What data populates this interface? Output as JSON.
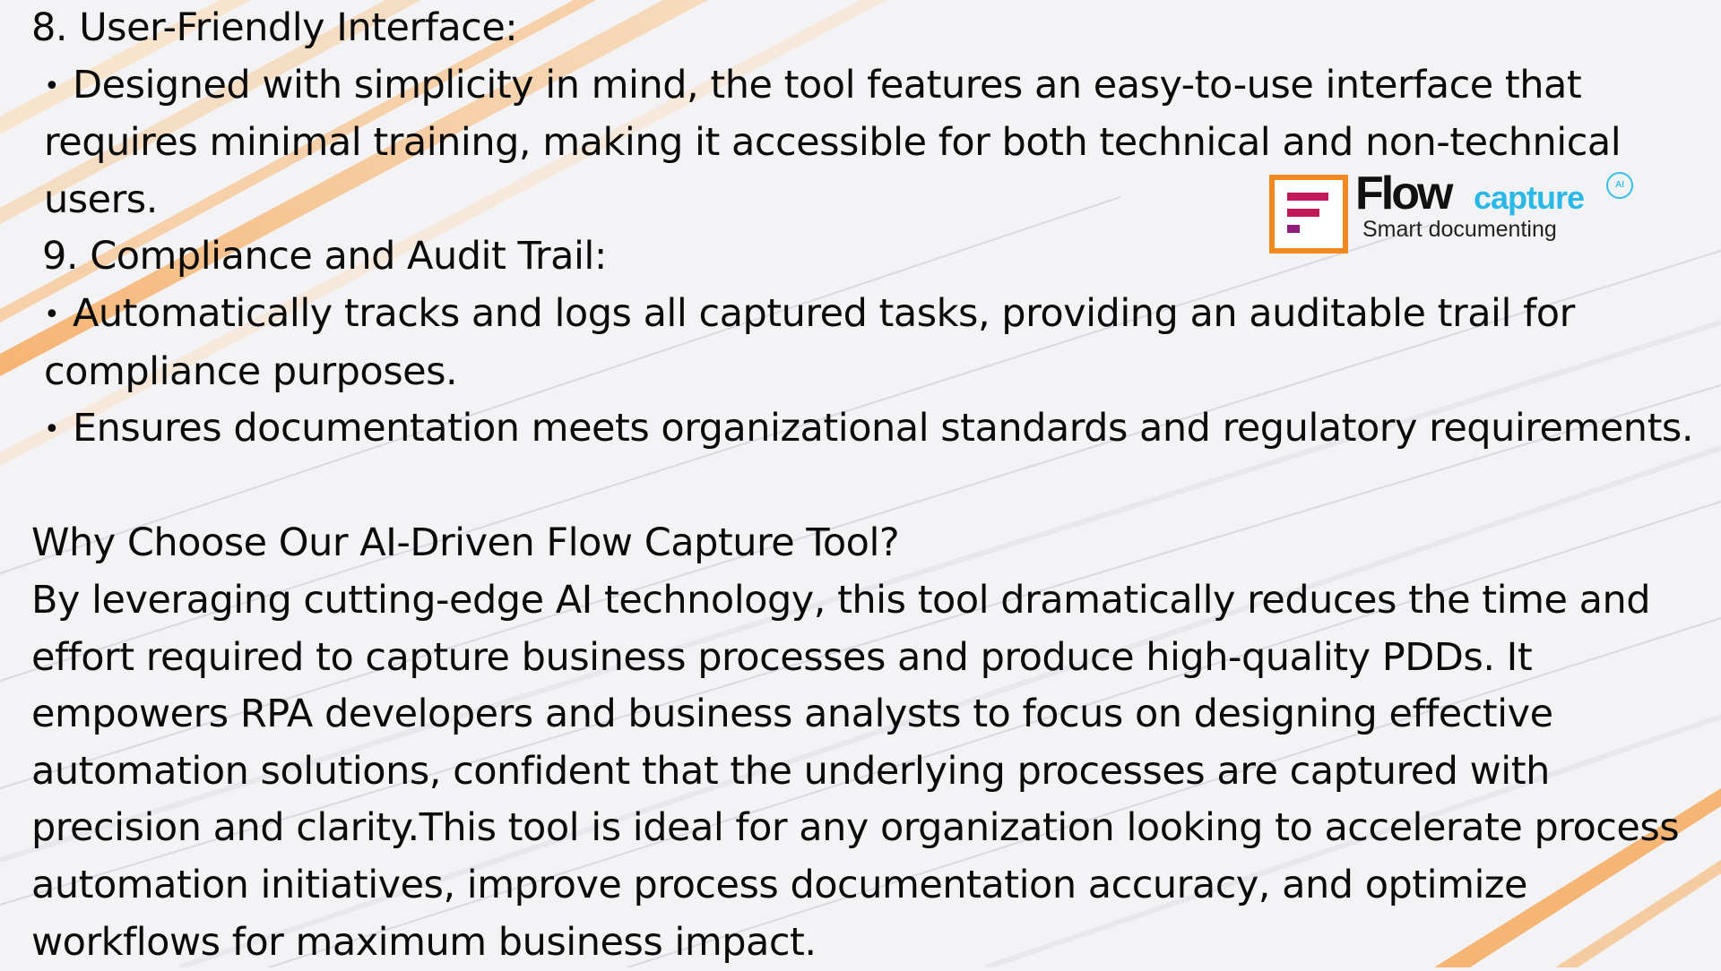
{
  "colors": {
    "text": "#0b0b0b",
    "background": "#f3f3f5",
    "accent_orange": "#f08a1e",
    "logo_blue": "#2ab9e6",
    "logo_magenta": "#c2185b"
  },
  "logo": {
    "brand_word": "Flow",
    "product_word": "capture",
    "ai_badge": "AI",
    "tagline": "Smart documenting"
  },
  "sections": {
    "s8": {
      "heading": "8. User-Friendly Interface:",
      "bullet_glyph": "•",
      "bullets": [
        "Designed with simplicity in mind, the tool features an easy-to-use interface that requires minimal training, making it accessible for both technical and non-technical users."
      ]
    },
    "s9": {
      "heading": "9. Compliance and Audit Trail:",
      "bullet_glyph": "•",
      "bullets": [
        "Automatically tracks and logs all captured tasks, providing an auditable trail for compliance purposes.",
        "Ensures documentation meets organizational standards and regulatory requirements."
      ]
    },
    "why": {
      "heading": "Why Choose Our AI-Driven Flow Capture Tool?",
      "body": "By leveraging cutting-edge AI technology, this tool dramatically reduces the time and effort required to capture business processes and produce high-quality PDDs. It empowers RPA developers and business analysts to focus on designing effective automation solutions, confident that the underlying processes are captured with precision and clarity.This tool is ideal for any organization looking to accelerate process automation initiatives, improve process documentation accuracy, and optimize workflows for maximum business impact."
    }
  }
}
